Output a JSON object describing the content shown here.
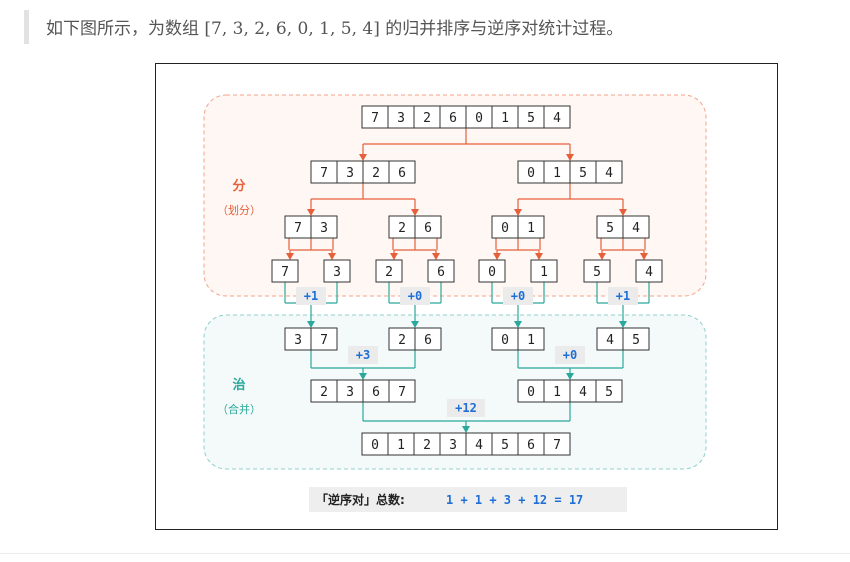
{
  "caption": {
    "prefix": "如下图所示，为数组 ",
    "array": "[7, 3, 2, 6, 0, 1, 5, 4]",
    "suffix": " 的归并排序与逆序对统计过程。"
  },
  "diagram": {
    "divide": {
      "title": "分",
      "subtitle": "（划分）"
    },
    "merge": {
      "title": "治",
      "subtitle": "（合并）"
    },
    "divide_levels": [
      [
        [
          7,
          3,
          2,
          6,
          0,
          1,
          5,
          4
        ]
      ],
      [
        [
          7,
          3,
          2,
          6
        ],
        [
          0,
          1,
          5,
          4
        ]
      ],
      [
        [
          7,
          3
        ],
        [
          2,
          6
        ],
        [
          0,
          1
        ],
        [
          5,
          4
        ]
      ],
      [
        [
          7
        ],
        [
          3
        ],
        [
          2
        ],
        [
          6
        ],
        [
          0
        ],
        [
          1
        ],
        [
          5
        ],
        [
          4
        ]
      ]
    ],
    "merge_levels": [
      [
        [
          3,
          7
        ],
        [
          2,
          6
        ],
        [
          0,
          1
        ],
        [
          4,
          5
        ]
      ],
      [
        [
          2,
          3,
          6,
          7
        ],
        [
          0,
          1,
          4,
          5
        ]
      ],
      [
        [
          0,
          1,
          2,
          3,
          4,
          5,
          6,
          7
        ]
      ]
    ],
    "inversion_counts": {
      "level1": [
        "+1",
        "+0",
        "+0",
        "+1"
      ],
      "level2": [
        "+3",
        "+0"
      ],
      "level3": [
        "+12"
      ]
    },
    "summary": {
      "label": "「逆序对」总数:",
      "expression": "1 + 1 + 3 + 12 = 17"
    },
    "colors": {
      "divide_arrow": "#e5603a",
      "merge_arrow": "#2aa89b",
      "count_text": "#1f6fd6",
      "divide_title": "#e5603a",
      "merge_title": "#2aa89b"
    }
  }
}
